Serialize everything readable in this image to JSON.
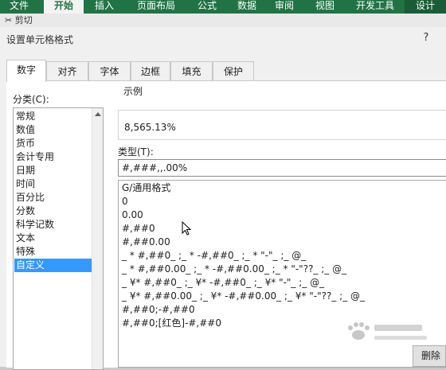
{
  "ribbon": {
    "tabs": [
      "文件",
      "开始",
      "插入",
      "页面布局",
      "公式",
      "数据",
      "审阅",
      "视图",
      "开发工具",
      "设计"
    ],
    "active": "开始",
    "toolbar_fragment": "剪切"
  },
  "dialog": {
    "title": "设置单元格格式",
    "help": "?",
    "tabs": [
      "数字",
      "对齐",
      "字体",
      "边框",
      "填充",
      "保护"
    ],
    "active_tab": "数字",
    "category_label": "分类(C):",
    "categories": [
      "常规",
      "数值",
      "货币",
      "会计专用",
      "日期",
      "时间",
      "百分比",
      "分数",
      "科学记数",
      "文本",
      "特殊",
      "自定义"
    ],
    "selected_category": "自定义",
    "sample_label": "示例",
    "sample_value": "8,565.13%",
    "type_label": "类型(T):",
    "type_value": "#,###,,.00%",
    "formats": [
      "G/通用格式",
      "0",
      "0.00",
      "#,##0",
      "#,##0.00",
      "_ * #,##0_ ;_ * -#,##0_ ;_ * \"-\"_ ;_ @_",
      "_ * #,##0.00_ ;_ * -#,##0.00_ ;_ * \"-\"??_ ;_ @_",
      "_ ¥* #,##0_ ;_ ¥* -#,##0_ ;_ ¥* \"-\"_ ;_ @_",
      "_ ¥* #,##0.00_ ;_ ¥* -#,##0.00_ ;_ ¥* \"-\"??_ ;_ @_",
      "#,##0;-#,##0",
      "#,##0;[红色]-#,##0"
    ],
    "delete_button_label": "删除"
  },
  "colors": {
    "ribbon": "#217346",
    "selection": "#3399ff"
  }
}
